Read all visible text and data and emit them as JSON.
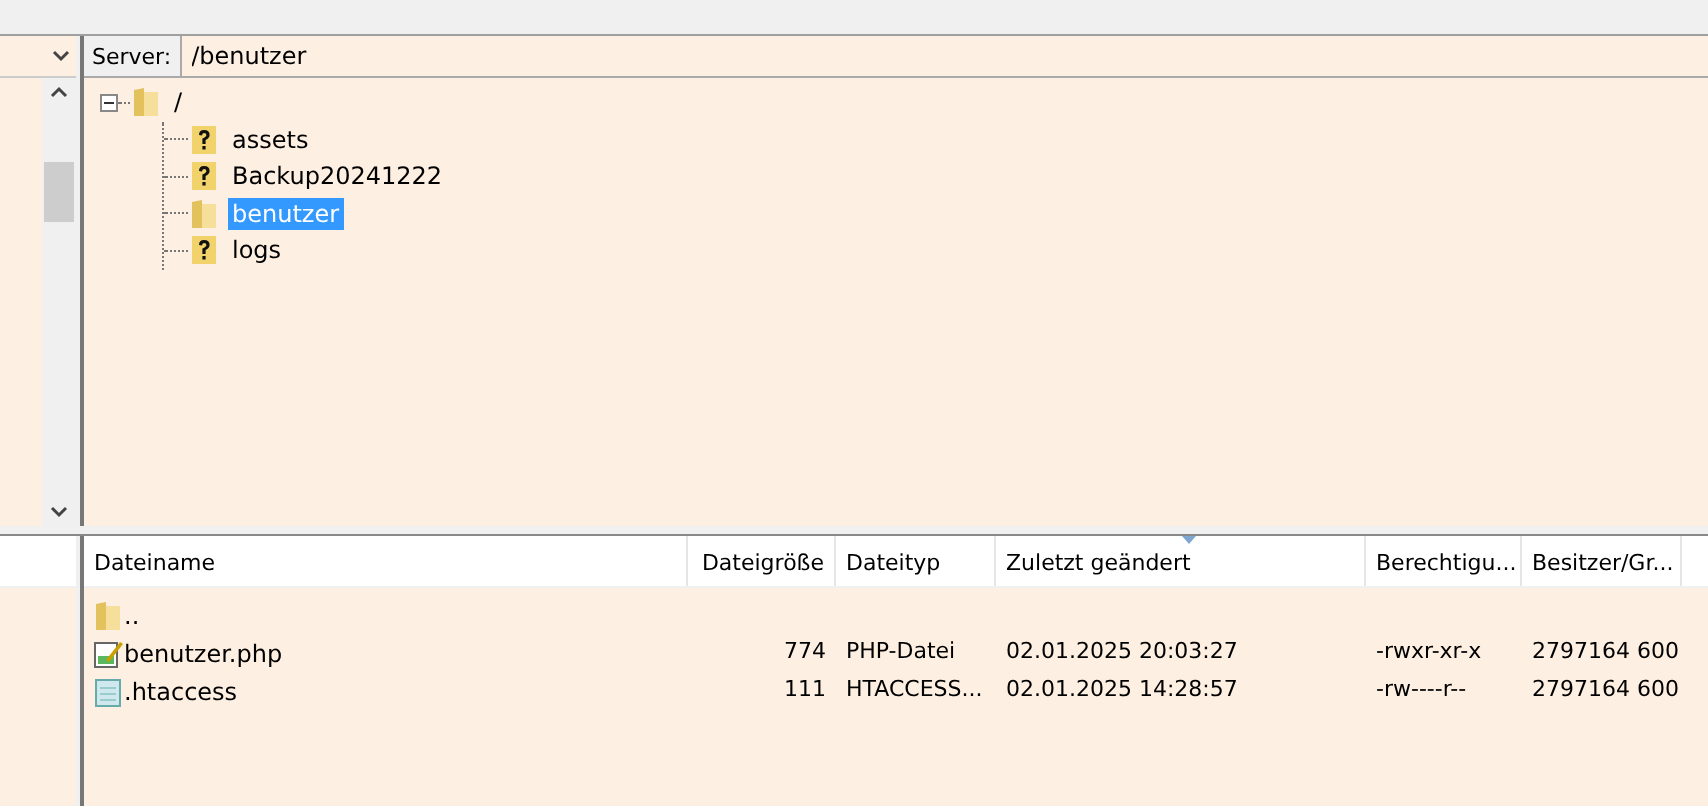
{
  "remote_site": {
    "label": "Server:",
    "path": "/benutzer",
    "tree": [
      {
        "name": "/",
        "kind": "folder",
        "expanded": true,
        "selected": false,
        "children": [
          {
            "name": "assets",
            "kind": "unknown",
            "selected": false
          },
          {
            "name": "Backup20241222",
            "kind": "unknown",
            "selected": false
          },
          {
            "name": "benutzer",
            "kind": "folder",
            "selected": true
          },
          {
            "name": "logs",
            "kind": "unknown",
            "selected": false
          }
        ]
      }
    ]
  },
  "file_list": {
    "columns": [
      {
        "label": "Dateiname",
        "sorted": false
      },
      {
        "label": "Dateigröße",
        "sorted": false
      },
      {
        "label": "Dateityp",
        "sorted": false
      },
      {
        "label": "Zuletzt geändert",
        "sorted": true
      },
      {
        "label": "Berechtigu...",
        "sorted": false
      },
      {
        "label": "Besitzer/Gr...",
        "sorted": false
      }
    ],
    "rows": [
      {
        "kind": "folder",
        "cells": [
          ".."
        ]
      },
      {
        "kind": "script",
        "cells": [
          "benutzer.php",
          "774",
          "PHP-Datei",
          "02.01.2025 20:03:27",
          "-rwxr-xr-x",
          "2797164 600"
        ]
      },
      {
        "kind": "text",
        "cells": [
          ".htaccess",
          "111",
          "HTACCESS...",
          "02.01.2025 14:28:57",
          "-rw----r--",
          "2797164 600"
        ]
      }
    ]
  }
}
